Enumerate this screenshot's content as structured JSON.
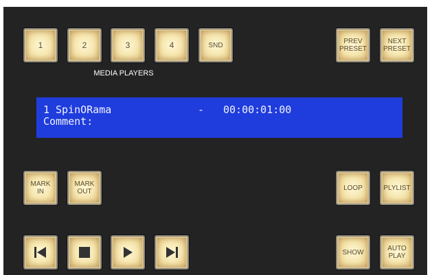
{
  "media_players": {
    "caption": "MEDIA PLAYERS",
    "buttons": [
      "1",
      "2",
      "3",
      "4",
      "SND"
    ]
  },
  "presets": {
    "prev": "PREV\nPRESET",
    "next": "NEXT\nPRESET"
  },
  "display": {
    "clip_number": "1",
    "clip_name": "SpinORama",
    "separator": "-",
    "timecode": "00:00:01:00",
    "comment_label": "Comment:"
  },
  "marks": {
    "mark_in": "MARK\nIN",
    "mark_out": "MARK\nOUT"
  },
  "modes": {
    "loop": "LOOP",
    "playlist": "PLYLIST",
    "show": "SHOW",
    "auto_play": "AUTO\nPLAY"
  },
  "transport": {
    "icons": [
      "skip-back-icon",
      "stop-icon",
      "play-icon",
      "skip-forward-icon"
    ],
    "icon_color": "#333333"
  },
  "colors": {
    "panel": "#232323",
    "lcd_background": "#1f3ddd",
    "lcd_text": "#f2f2ff",
    "button_face": "#f6e7b0"
  }
}
